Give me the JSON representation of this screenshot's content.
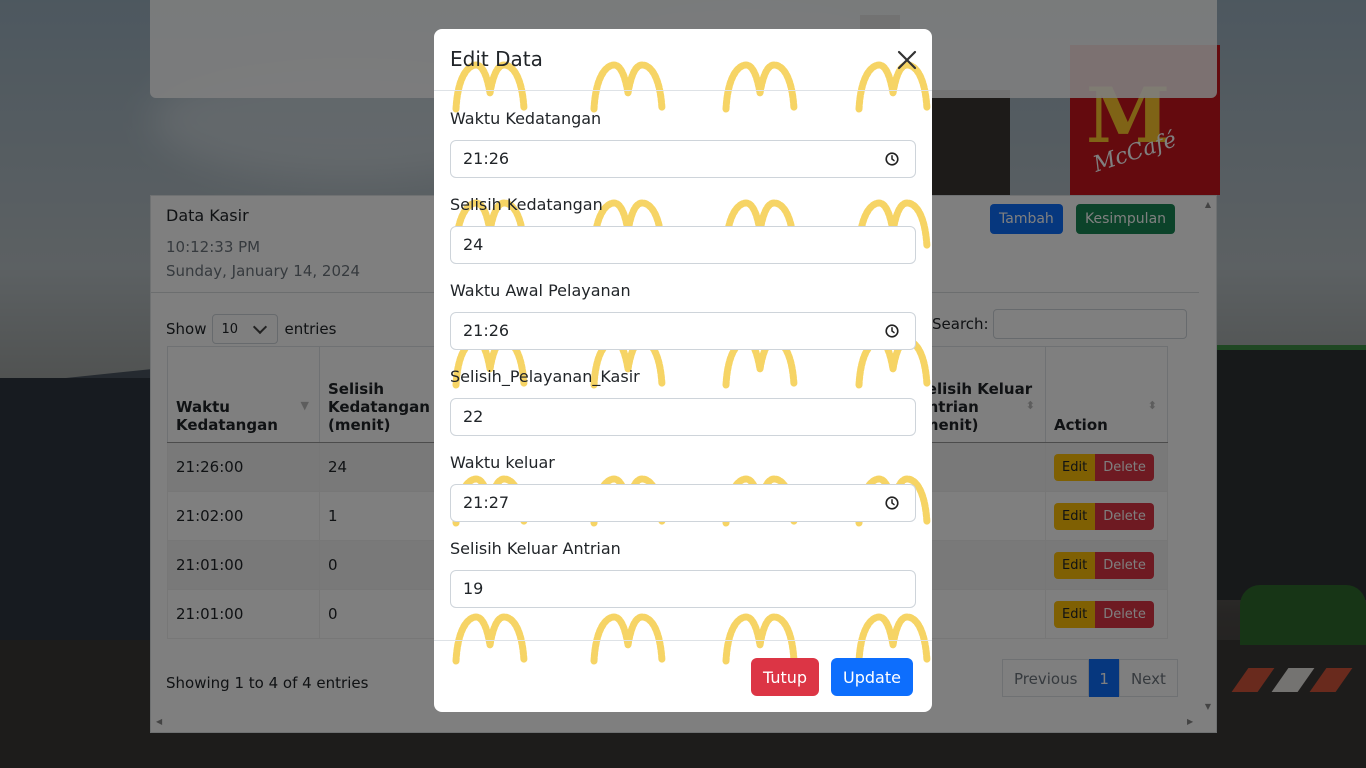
{
  "card": {
    "title": "Data Kasir",
    "time": "10:12:33 PM",
    "date": "Sunday, January 14, 2024",
    "buttons": {
      "tambah": "Tambah",
      "kesimpulan": "Kesimpulan"
    }
  },
  "datatable": {
    "show_label": "Show",
    "length_value": "10",
    "entries_label": "entries",
    "search_label": "Search:",
    "columns": [
      "Waktu Kedatangan",
      "Selisih Kedatangan (menit)",
      "Selisih Keluar Antrian (menit)",
      "Action"
    ],
    "rows": [
      {
        "waktu_kedatangan": "21:26:00",
        "selisih_kedatangan": "24"
      },
      {
        "waktu_kedatangan": "21:02:00",
        "selisih_kedatangan": "1"
      },
      {
        "waktu_kedatangan": "21:01:00",
        "selisih_kedatangan": "0"
      },
      {
        "waktu_kedatangan": "21:01:00",
        "selisih_kedatangan": "0"
      }
    ],
    "action_edit": "Edit",
    "action_delete": "Delete",
    "info": "Showing 1 to 4 of 4 entries",
    "pagination": {
      "previous": "Previous",
      "page": "1",
      "next": "Next"
    }
  },
  "modal": {
    "title": "Edit Data",
    "fields": [
      {
        "label": "Waktu Kedatangan",
        "value": "21:26",
        "type": "time"
      },
      {
        "label": "Selisih Kedatangan",
        "value": "24",
        "type": "number"
      },
      {
        "label": "Waktu Awal Pelayanan",
        "value": "21:26",
        "type": "time"
      },
      {
        "label": "Selisih_Pelayanan_Kasir",
        "value": "22",
        "type": "number"
      },
      {
        "label": "Waktu keluar",
        "value": "21:27",
        "type": "time"
      },
      {
        "label": "Selisih Keluar Antrian",
        "value": "19",
        "type": "number"
      }
    ],
    "buttons": {
      "tutup": "Tutup",
      "update": "Update"
    }
  },
  "background": {
    "brand_logo": "M",
    "brand_text": "McCafé"
  },
  "colors": {
    "primary": "#0d6efd",
    "success": "#198754",
    "danger": "#dc3545",
    "warning": "#ffc107",
    "pattern": "#f3c531"
  },
  "icons": {
    "close": "close-icon",
    "clock": "clock-icon",
    "chevron": "chevron-down-icon",
    "sort": "sort-icon"
  }
}
